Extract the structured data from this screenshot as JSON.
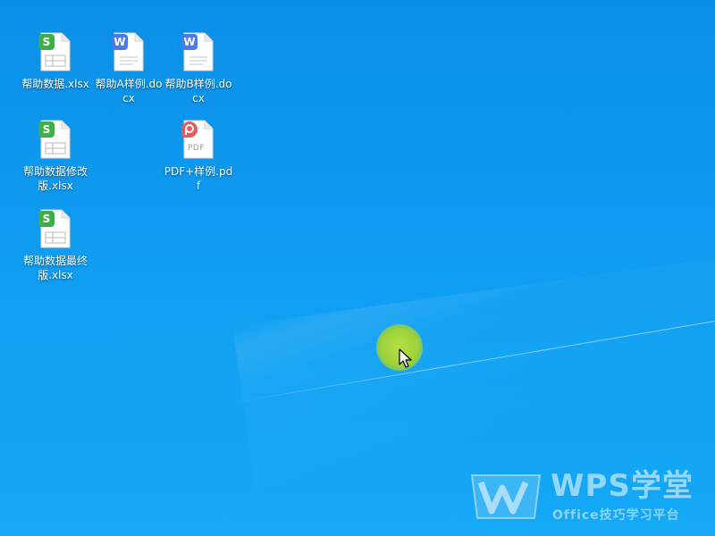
{
  "desktop": {
    "icons": [
      {
        "label": "帮助数据.xlsx",
        "type": "spreadsheet",
        "badge": "S",
        "icon": "wps-spreadsheet-icon"
      },
      {
        "label": "帮助A样例.docx",
        "type": "document",
        "badge": "W",
        "icon": "wps-writer-icon"
      },
      {
        "label": "帮助B样例.docx",
        "type": "document",
        "badge": "W",
        "icon": "wps-writer-icon"
      },
      {
        "label": "帮助数据修改版.xlsx",
        "type": "spreadsheet",
        "badge": "S",
        "icon": "wps-spreadsheet-icon"
      },
      {
        "label": "PDF+样例.pdf",
        "type": "pdf",
        "badge": "",
        "icon": "wps-pdf-icon",
        "file_mark": "PDF"
      },
      {
        "label": "帮助数据最终版.xlsx",
        "type": "spreadsheet",
        "badge": "S",
        "icon": "wps-spreadsheet-icon"
      }
    ]
  },
  "watermark": {
    "title": "WPS学堂",
    "subtitle": "Office技巧学习平台",
    "icon": "wps-logo-icon"
  },
  "cursor": {
    "icon": "mouse-pointer-icon"
  },
  "colors": {
    "background": "#0e9af0",
    "spreadsheet": "#3fae49",
    "writer": "#4a79e8",
    "pdf": "#e65a5a",
    "click_highlight": "#a8d83c"
  }
}
